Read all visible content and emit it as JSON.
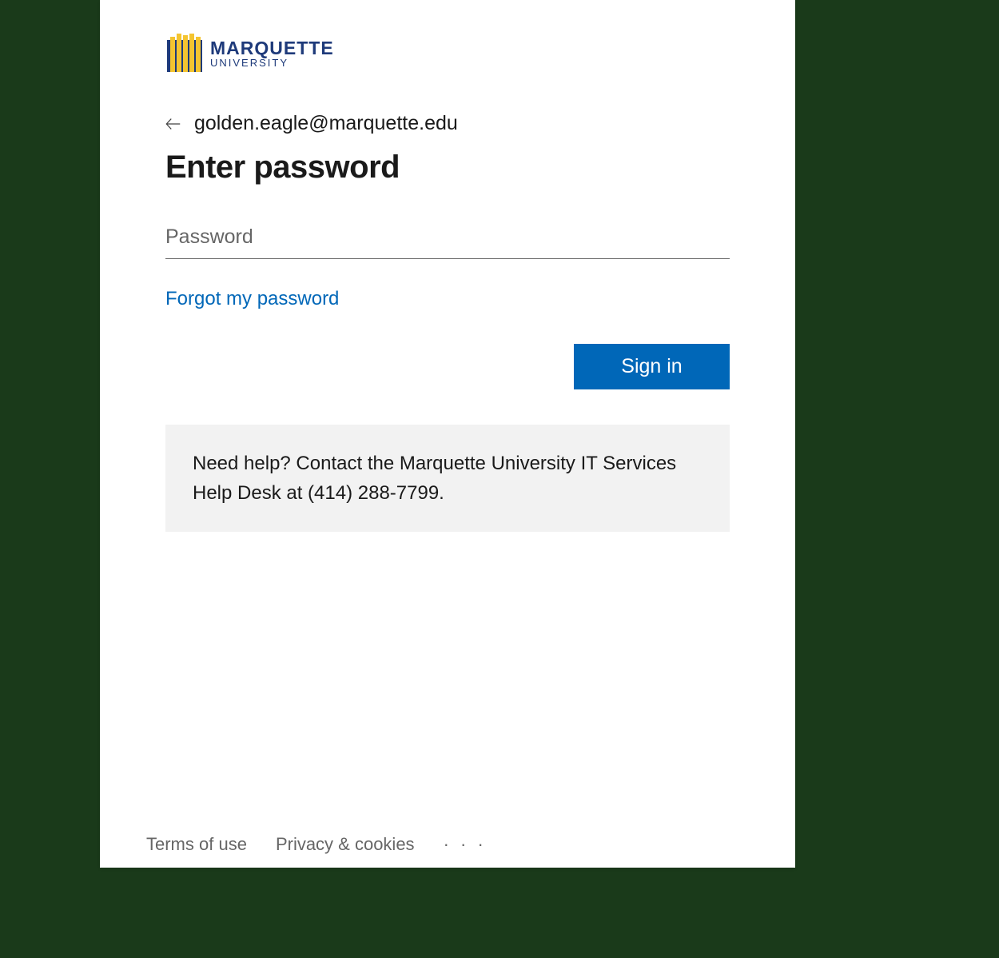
{
  "brand": {
    "name": "MARQUETTE",
    "subname": "UNIVERSITY"
  },
  "identity": {
    "email": "golden.eagle@marquette.edu"
  },
  "form": {
    "title": "Enter password",
    "password_placeholder": "Password",
    "password_value": "",
    "forgot_label": "Forgot my password",
    "signin_label": "Sign in"
  },
  "help": {
    "text": "Need help? Contact the Marquette University IT Services Help Desk at (414) 288-7799."
  },
  "footer": {
    "terms": "Terms of use",
    "privacy": "Privacy & cookies",
    "more_glyph": "· · ·"
  },
  "colors": {
    "primary": "#0067b8",
    "brand_navy": "#1e3a7a",
    "brand_gold": "#f4c430"
  }
}
